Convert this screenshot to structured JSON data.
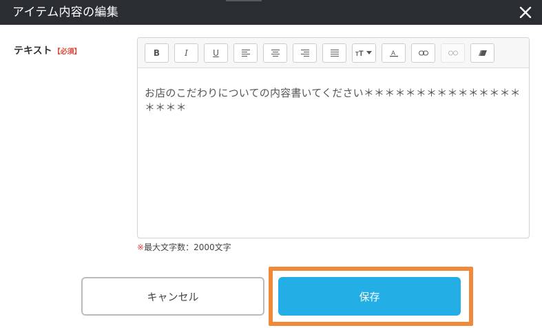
{
  "dialog": {
    "title": "アイテム内容の編集",
    "close_icon": "close-icon"
  },
  "field": {
    "label": "テキスト",
    "required_badge": "【必須】"
  },
  "toolbar": {
    "buttons": [
      {
        "name": "bold",
        "icon": "B"
      },
      {
        "name": "italic",
        "icon": "I"
      },
      {
        "name": "underline",
        "icon": "U"
      },
      {
        "name": "align-left",
        "icon": "align-left-icon"
      },
      {
        "name": "align-center",
        "icon": "align-center-icon"
      },
      {
        "name": "align-right",
        "icon": "align-right-icon"
      },
      {
        "name": "justify",
        "icon": "justify-icon"
      },
      {
        "name": "font-size",
        "icon": "tT"
      },
      {
        "name": "font-color",
        "icon": "A"
      },
      {
        "name": "link",
        "icon": "link-icon"
      },
      {
        "name": "unlink",
        "icon": "unlink-icon"
      },
      {
        "name": "eraser",
        "icon": "eraser-icon"
      }
    ]
  },
  "editor": {
    "content": "お店のこだわりについての内容書いてください＊＊＊＊＊＊＊＊＊＊＊＊＊＊＊＊＊＊＊"
  },
  "note": {
    "mark": "※",
    "text": "最大文字数：2000文字"
  },
  "actions": {
    "cancel_label": "キャンセル",
    "save_label": "保存"
  },
  "colors": {
    "header_bg": "#2a2e33",
    "save_bg": "#23aee5",
    "highlight": "#f08a3a",
    "required": "#e0463a"
  }
}
